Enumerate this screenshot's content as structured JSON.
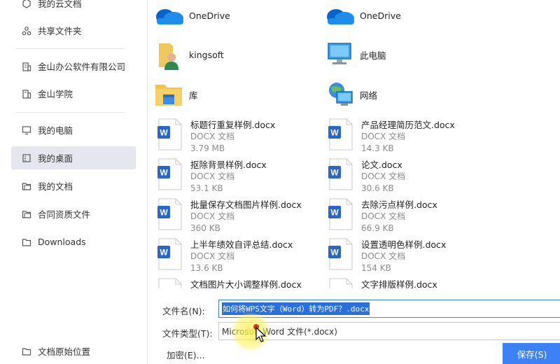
{
  "sidebar": {
    "items": [
      {
        "label": "我的云文档",
        "icon": "cloud-doc-icon"
      },
      {
        "label": "共享文件夹",
        "icon": "share-folder-icon"
      },
      {
        "label": "金山办公软件有限公司",
        "icon": "company-icon"
      },
      {
        "label": "金山学院",
        "icon": "academy-icon"
      },
      {
        "label": "我的电脑",
        "icon": "computer-icon"
      },
      {
        "label": "我的桌面",
        "icon": "desktop-icon"
      },
      {
        "label": "我的文档",
        "icon": "documents-icon"
      },
      {
        "label": "合同资质文件",
        "icon": "folder-icon"
      },
      {
        "label": "Downloads",
        "icon": "folder-icon"
      }
    ],
    "bottom_label": "文档原始位置"
  },
  "locations": [
    {
      "name": "OneDrive",
      "icon": "onedrive-icon"
    },
    {
      "name": "OneDrive",
      "icon": "onedrive-icon"
    },
    {
      "name": "kingsoft",
      "icon": "user-icon"
    },
    {
      "name": "此电脑",
      "icon": "pc-icon"
    },
    {
      "name": "库",
      "icon": "library-icon"
    },
    {
      "name": "网络",
      "icon": "network-icon"
    }
  ],
  "files": [
    {
      "name": "标题行重复样例.docx",
      "type": "DOCX 文档",
      "size": "3.79 MB"
    },
    {
      "name": "产品经理简历范文.docx",
      "type": "DOCX 文档",
      "size": "14.3 KB"
    },
    {
      "name": "抠除背景样例.docx",
      "type": "DOCX 文档",
      "size": "53.1 KB"
    },
    {
      "name": "论文.docx",
      "type": "DOCX 文档",
      "size": "30.6 KB"
    },
    {
      "name": "批量保存文档图片样例.docx",
      "type": "DOCX 文档",
      "size": "360 KB"
    },
    {
      "name": "去除污点样例.docx",
      "type": "DOCX 文档",
      "size": "66.9 KB"
    },
    {
      "name": "上半年绩效自评总结.docx",
      "type": "DOCX 文档",
      "size": "13.6 KB"
    },
    {
      "name": "设置透明色样例.docx",
      "type": "DOCX 文档",
      "size": "154 KB"
    },
    {
      "name": "文档图片大小调整样例.docx",
      "type": "",
      "size": ""
    },
    {
      "name": "文字排版样例.docx",
      "type": "",
      "size": ""
    }
  ],
  "form": {
    "filename_label": "文件名(N):",
    "filename_value": "如何将WPS文字（Word）转为PDF？.docx",
    "filetype_label": "文件类型(T):",
    "filetype_value": "Microsoft Word 文件(*.docx)",
    "encrypt_label": "加密(E)...",
    "save_label": "保存(S)"
  },
  "colors": {
    "accent": "#3c82f6",
    "word_blue": "#2b65c8",
    "selection": "#2a6fdb"
  }
}
